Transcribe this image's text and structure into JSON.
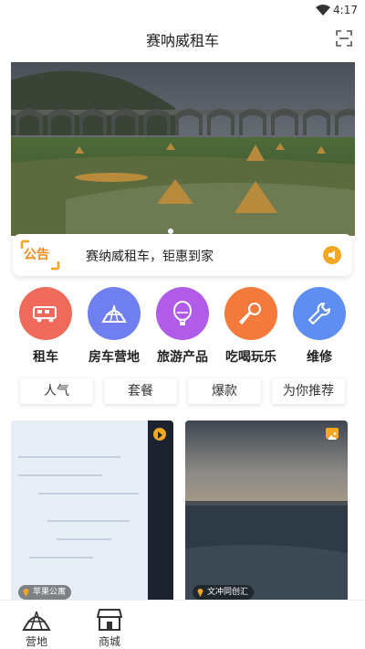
{
  "status_bar": {
    "time": "4:17"
  },
  "header": {
    "title": "赛呐威租车"
  },
  "notice": {
    "badge": "公告",
    "text": "赛纳威租车，钜惠到家"
  },
  "categories": [
    {
      "label": "租车",
      "icon": "rv-icon",
      "color": "#f06a5c"
    },
    {
      "label": "房车营地",
      "icon": "tent-icon",
      "color": "#6f7ff0"
    },
    {
      "label": "旅游产品",
      "icon": "balloon-icon",
      "color": "#b05ce8"
    },
    {
      "label": "吃喝玩乐",
      "icon": "microphone-icon",
      "color": "#f47a3c"
    },
    {
      "label": "维修",
      "icon": "wrench-icon",
      "color": "#5f8ef2"
    }
  ],
  "tabs": [
    "人气",
    "套餐",
    "爆款",
    "为你推荐"
  ],
  "cards": [
    {
      "location": "苹果公寓",
      "badge_icon": "play-icon"
    },
    {
      "location": "文冲同创汇",
      "badge_icon": "image-icon"
    }
  ],
  "bottom_nav": [
    {
      "label": "营地",
      "icon": "campsite-icon"
    },
    {
      "label": "商城",
      "icon": "store-icon"
    }
  ]
}
